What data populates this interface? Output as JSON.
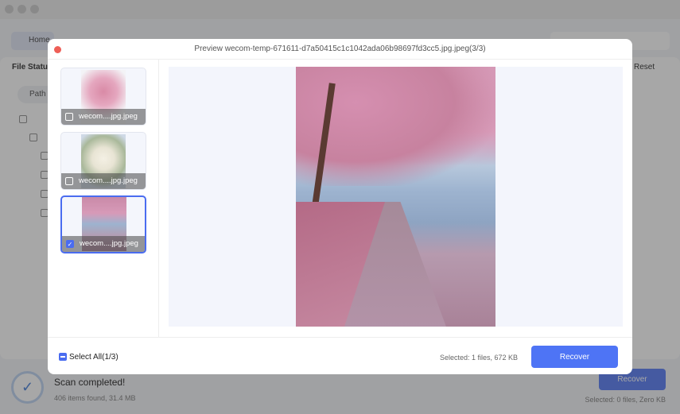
{
  "background": {
    "home_label": "Home",
    "file_status_label": "File Status",
    "reset_label": "Reset",
    "path_label": "Path",
    "scan_title": "Scan completed!",
    "scan_summary": "406 items found, 31.4 MB",
    "recover_label": "Recover",
    "selected_summary": "Selected: 0 files, Zero KB"
  },
  "modal": {
    "title": "Preview wecom-temp-671611-d7a50415c1c1042ada06b98697fd3cc5.jpg.jpeg(3/3)",
    "thumbnails": [
      {
        "label": "wecom....jpg.jpeg",
        "checked": false
      },
      {
        "label": "wecom....jpg.jpeg",
        "checked": false
      },
      {
        "label": "wecom....jpg.jpeg",
        "checked": true
      }
    ],
    "select_all_label": "Select All(1/3)",
    "selected_summary": "Selected: 1 files, 672 KB",
    "recover_label": "Recover"
  },
  "colors": {
    "accent": "#4e74f5",
    "close": "#ee5f57"
  }
}
